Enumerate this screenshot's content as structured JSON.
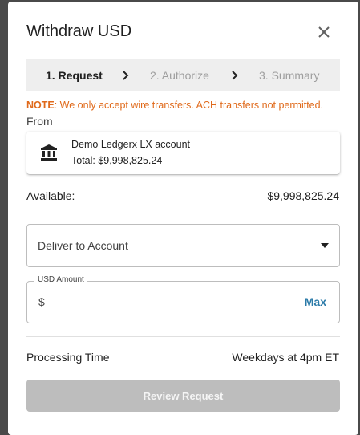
{
  "dialog": {
    "title": "Withdraw USD"
  },
  "stepper": {
    "steps": [
      {
        "label": "1. Request",
        "active": true
      },
      {
        "label": "2. Authorize",
        "active": false
      },
      {
        "label": "3. Summary",
        "active": false
      }
    ]
  },
  "note": {
    "prefix": "NOTE",
    "text": ": We only accept wire transfers. ACH transfers not permitted."
  },
  "from": {
    "label": "From",
    "account_name": "Demo Ledgerx LX account",
    "account_total": "Total: $9,998,825.24",
    "icon": "bank-icon"
  },
  "available": {
    "label": "Available:",
    "value": "$9,998,825.24"
  },
  "deliver": {
    "label": "Deliver to Account"
  },
  "amount": {
    "label": "USD Amount",
    "prefix": "$",
    "value": "",
    "max_label": "Max"
  },
  "processing": {
    "label": "Processing Time",
    "value": "Weekdays at 4pm ET"
  },
  "review_button": {
    "label": "Review Request",
    "disabled": true
  },
  "colors": {
    "note": "#e06a1b",
    "max": "#2a7aa8",
    "disabled_button": "#bdbdbd",
    "stepper_bg": "#eeeeee"
  }
}
